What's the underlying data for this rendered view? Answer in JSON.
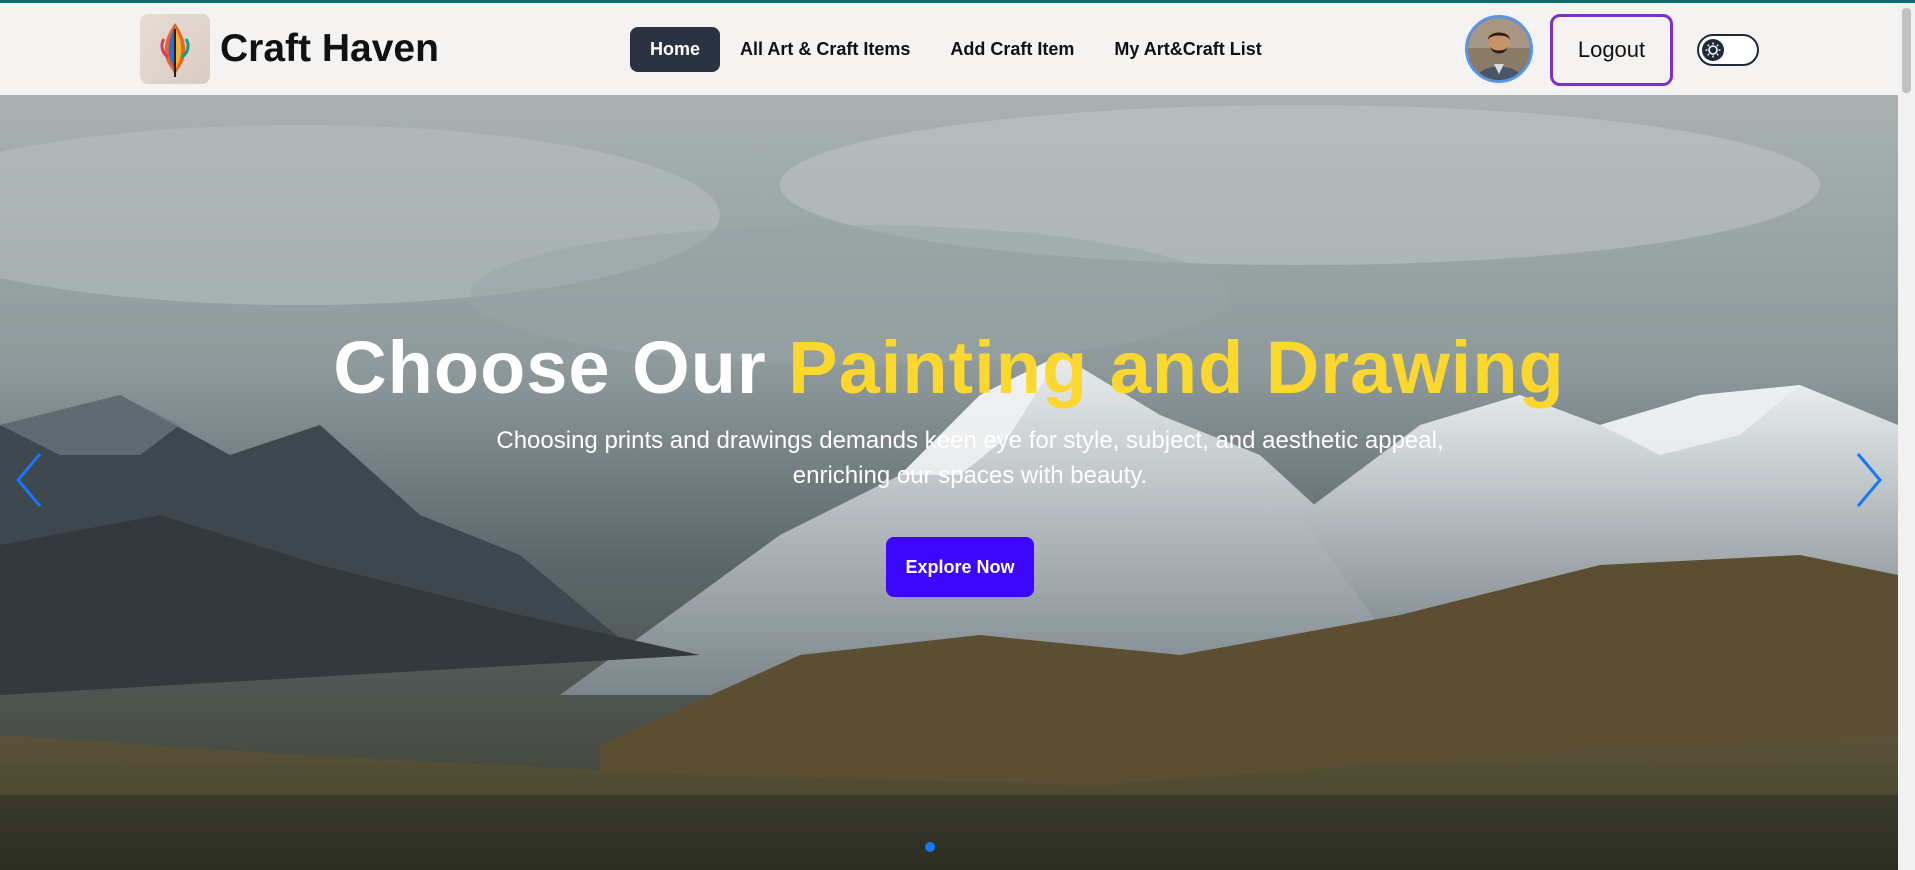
{
  "brand": {
    "name": "Craft Haven",
    "logo_icon": "feather-logo-icon"
  },
  "nav": {
    "items": [
      {
        "label": "Home",
        "active": true
      },
      {
        "label": "All Art & Craft Items",
        "active": false
      },
      {
        "label": "Add Craft Item",
        "active": false
      },
      {
        "label": "My Art&Craft List",
        "active": false
      }
    ]
  },
  "user": {
    "avatar_icon": "user-avatar",
    "logout_label": "Logout"
  },
  "theme_toggle": {
    "icon": "sun-icon",
    "state": "light"
  },
  "hero": {
    "title_main": "Choose Our ",
    "title_accent": "Painting and Drawing",
    "subtitle": "Choosing prints and drawings demands keen eye for style, subject, and aesthetic appeal, enriching our spaces with beauty.",
    "cta_label": "Explore Now",
    "prev_icon": "chevron-left-icon",
    "next_icon": "chevron-right-icon",
    "active_slide": 1
  },
  "colors": {
    "accent_yellow": "#fcd82e",
    "cta_blue": "#3b07ff",
    "logout_border": "#7d2fd0",
    "nav_active_bg": "#2b3241",
    "pagination_dot": "#1677ff"
  }
}
